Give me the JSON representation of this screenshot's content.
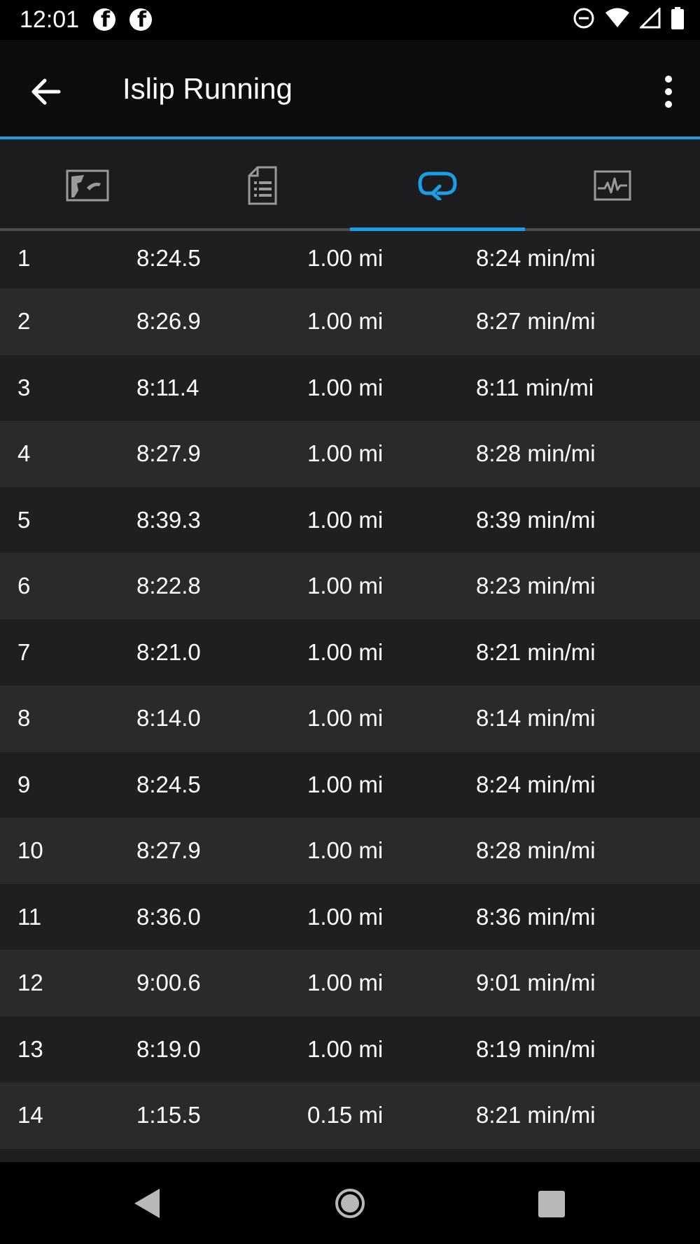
{
  "status_bar": {
    "time": "12:01",
    "left_icons": [
      "facebook-icon",
      "facebook-icon"
    ],
    "right_icons": [
      "do-not-disturb-icon",
      "wifi-icon",
      "cell-signal-icon",
      "battery-icon"
    ]
  },
  "app_bar": {
    "title": "Islip Running",
    "back_icon": "arrow-back-icon",
    "menu_icon": "more-vert-icon"
  },
  "tabs": [
    {
      "icon": "map-icon",
      "active": false
    },
    {
      "icon": "document-list-icon",
      "active": false
    },
    {
      "icon": "laps-icon",
      "active": true
    },
    {
      "icon": "chart-icon",
      "active": false
    }
  ],
  "colors": {
    "accent": "#1a9ee6",
    "row_dark": "#1f1f20",
    "row_light": "#2a2a2b",
    "icon_gray": "#9a9a9a"
  },
  "laps": [
    {
      "lap": "1",
      "time": "8:24.5",
      "distance": "1.00 mi",
      "pace": "8:24 min/mi"
    },
    {
      "lap": "2",
      "time": "8:26.9",
      "distance": "1.00 mi",
      "pace": "8:27 min/mi"
    },
    {
      "lap": "3",
      "time": "8:11.4",
      "distance": "1.00 mi",
      "pace": "8:11 min/mi"
    },
    {
      "lap": "4",
      "time": "8:27.9",
      "distance": "1.00 mi",
      "pace": "8:28 min/mi"
    },
    {
      "lap": "5",
      "time": "8:39.3",
      "distance": "1.00 mi",
      "pace": "8:39 min/mi"
    },
    {
      "lap": "6",
      "time": "8:22.8",
      "distance": "1.00 mi",
      "pace": "8:23 min/mi"
    },
    {
      "lap": "7",
      "time": "8:21.0",
      "distance": "1.00 mi",
      "pace": "8:21 min/mi"
    },
    {
      "lap": "8",
      "time": "8:14.0",
      "distance": "1.00 mi",
      "pace": "8:14 min/mi"
    },
    {
      "lap": "9",
      "time": "8:24.5",
      "distance": "1.00 mi",
      "pace": "8:24 min/mi"
    },
    {
      "lap": "10",
      "time": "8:27.9",
      "distance": "1.00 mi",
      "pace": "8:28 min/mi"
    },
    {
      "lap": "11",
      "time": "8:36.0",
      "distance": "1.00 mi",
      "pace": "8:36 min/mi"
    },
    {
      "lap": "12",
      "time": "9:00.6",
      "distance": "1.00 mi",
      "pace": "9:01 min/mi"
    },
    {
      "lap": "13",
      "time": "8:19.0",
      "distance": "1.00 mi",
      "pace": "8:19 min/mi"
    },
    {
      "lap": "14",
      "time": "1:15.5",
      "distance": "0.15 mi",
      "pace": "8:21 min/mi"
    }
  ],
  "nav_bar": {
    "icons": [
      "nav-back-icon",
      "nav-home-icon",
      "nav-recents-icon"
    ]
  }
}
